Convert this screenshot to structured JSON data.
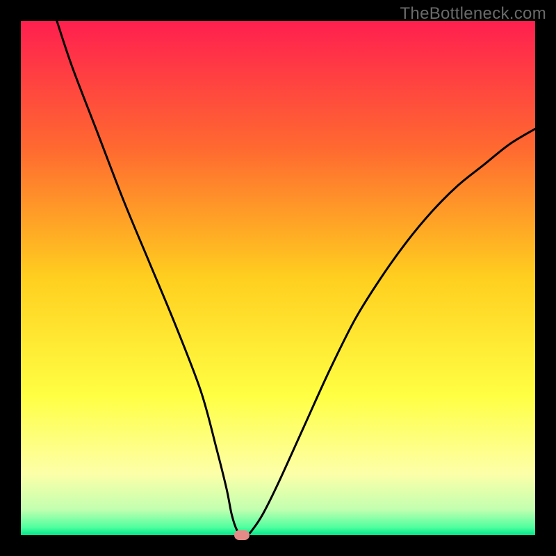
{
  "watermark": "TheBottleneck.com",
  "chart_data": {
    "type": "line",
    "title": "",
    "xlabel": "",
    "ylabel": "",
    "xlim": [
      0,
      100
    ],
    "ylim": [
      0,
      100
    ],
    "grid": false,
    "legend": false,
    "series": [
      {
        "name": "bottleneck-curve",
        "x": [
          7,
          10,
          15,
          20,
          25,
          30,
          35,
          38,
          40,
          41,
          42,
          43,
          44,
          45,
          47,
          50,
          55,
          60,
          65,
          70,
          75,
          80,
          85,
          90,
          95,
          100
        ],
        "values": [
          100,
          91,
          78,
          65,
          53,
          41,
          28,
          17,
          9,
          4,
          1,
          0,
          0,
          1,
          4,
          10,
          21,
          32,
          42,
          50,
          57,
          63,
          68,
          72,
          76,
          79
        ]
      }
    ],
    "annotations": [
      {
        "name": "min-marker",
        "x": 43,
        "y": 0,
        "color": "#e58b87"
      }
    ],
    "background_gradient": {
      "stops": [
        {
          "offset": 0.0,
          "color": "#ff1f4f"
        },
        {
          "offset": 0.25,
          "color": "#ff6a30"
        },
        {
          "offset": 0.5,
          "color": "#ffcf1f"
        },
        {
          "offset": 0.73,
          "color": "#ffff44"
        },
        {
          "offset": 0.88,
          "color": "#fdffa8"
        },
        {
          "offset": 0.95,
          "color": "#c2ffb0"
        },
        {
          "offset": 0.985,
          "color": "#4fff9f"
        },
        {
          "offset": 1.0,
          "color": "#00e58a"
        }
      ]
    },
    "curve_color": "#000000",
    "curve_width": 3
  }
}
